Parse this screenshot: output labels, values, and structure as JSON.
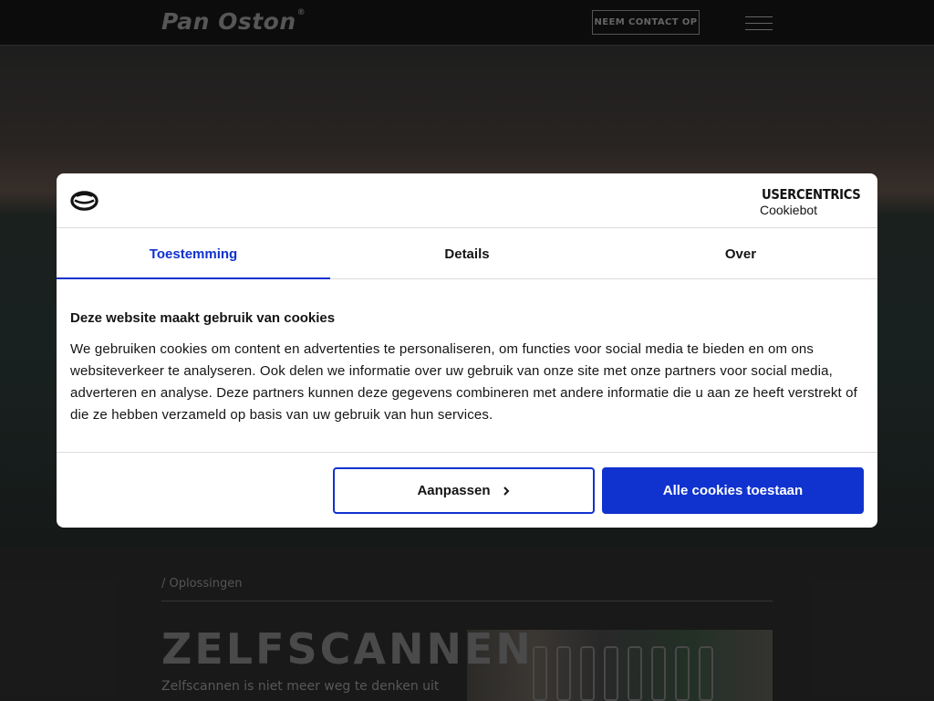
{
  "site": {
    "logo_text": "Pan Oston",
    "logo_registered": "®",
    "contact_label": "NEEM CONTACT OP",
    "breadcrumb": "/ Oplossingen",
    "section_title": "ZELFSCANNEN",
    "section_intro": "Zelfscannen is niet meer weg te denken uit de"
  },
  "cookie_dialog": {
    "brand_name": "USERCENTRICS",
    "brand_sub": "Cookiebot",
    "tabs": [
      {
        "label": "Toestemming",
        "active": true
      },
      {
        "label": "Details",
        "active": false
      },
      {
        "label": "Over",
        "active": false
      }
    ],
    "title": "Deze website maakt gebruik van cookies",
    "text": "We gebruiken cookies om content en advertenties te personaliseren, om functies voor social media te bieden en om ons websiteverkeer te analyseren. Ook delen we informatie over uw gebruik van onze site met onze partners voor social media, adverteren en analyse. Deze partners kunnen deze gegevens combineren met andere informatie die u aan ze heeft verstrekt of die ze hebben verzameld op basis van uw gebruik van hun services.",
    "customize_label": "Aanpassen",
    "allow_all_label": "Alle cookies toestaan"
  },
  "colors": {
    "accent": "#1032cf",
    "text": "#141414",
    "divider": "#dcdcdc"
  }
}
